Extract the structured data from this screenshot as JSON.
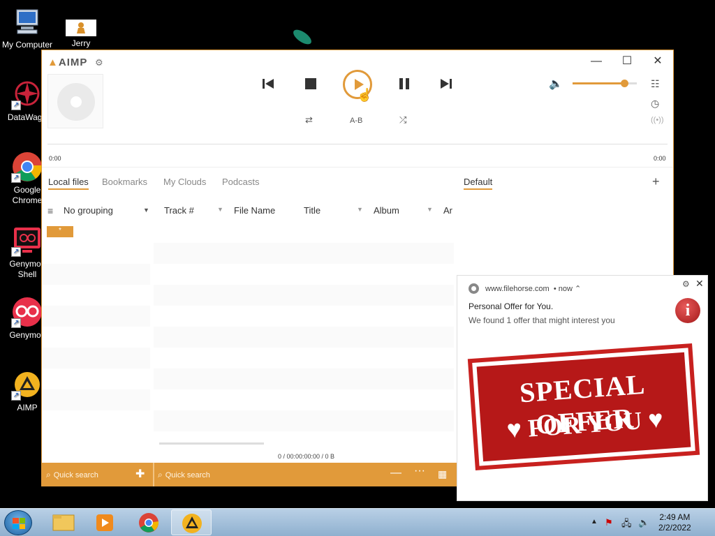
{
  "desktop": {
    "icons": [
      {
        "label": "My Computer",
        "icon": "computer-icon"
      },
      {
        "label": "Jerry",
        "icon": "jerry-icon"
      },
      {
        "label": "DataWago",
        "icon": "datawago-icon"
      },
      {
        "label": "Google Chrome",
        "icon": "chrome-icon"
      },
      {
        "label": "Genymoti Shell",
        "icon": "genymotion-shell-icon"
      },
      {
        "label": "Genymoti",
        "icon": "genymotion-icon"
      },
      {
        "label": "AIMP",
        "icon": "aimp-icon"
      }
    ]
  },
  "aimp": {
    "logo": "AIMP",
    "ab_label": "A-B",
    "time_elapsed": "0:00",
    "time_total": "0:00",
    "volume_percent": 80,
    "tabs": [
      "Local files",
      "Bookmarks",
      "My Clouds",
      "Podcasts"
    ],
    "active_tab": "Local files",
    "playlist_tab": "Default",
    "grouping": "No grouping",
    "group_tag": "*",
    "columns": [
      "Track #",
      "File Name",
      "Title",
      "Album",
      "Ar"
    ],
    "status": "0 / 00:00:00:00 / 0 B",
    "search_left_placeholder": "Quick search",
    "search_right_placeholder": "Quick search"
  },
  "notification": {
    "site": "www.filehorse.com",
    "when": "now",
    "title": "Personal Offer for You.",
    "body": "We found 1 offer that might interest you",
    "stamp_line1": "SPECIAL OFFER",
    "stamp_line2": "♥ FOR YOU ♥"
  },
  "taskbar": {
    "time": "2:49 AM",
    "date": "2/2/2022"
  },
  "colors": {
    "accent": "#e19a3a",
    "stamp_red": "#b61818"
  }
}
